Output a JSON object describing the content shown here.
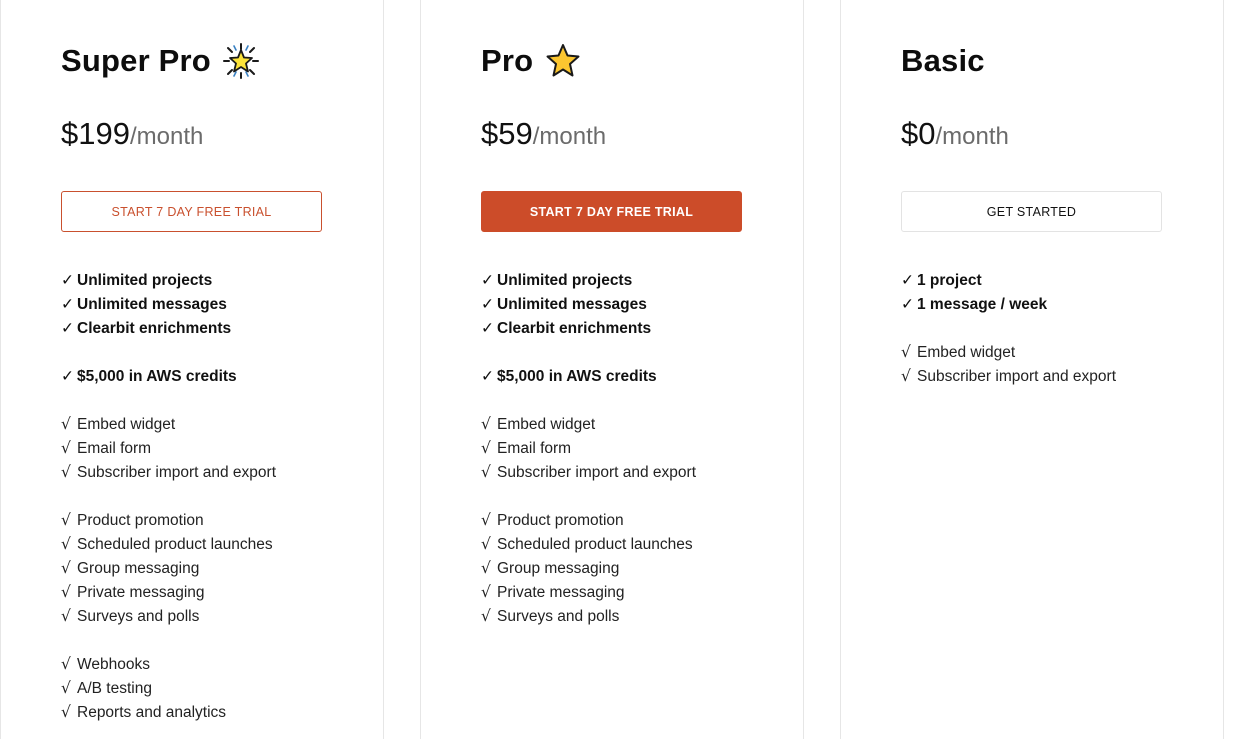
{
  "plans": [
    {
      "name": "Super Pro",
      "icon": "sparkle-star-icon",
      "price": "$199",
      "period": "/month",
      "cta": "START 7 DAY FREE TRIAL",
      "cta_style": "outline-accent",
      "groups": [
        {
          "bold": true,
          "items": [
            "Unlimited projects",
            "Unlimited messages",
            "Clearbit enrichments"
          ]
        },
        {
          "bold": true,
          "items": [
            "$5,000 in AWS credits"
          ]
        },
        {
          "bold": false,
          "items": [
            "Embed widget",
            "Email form",
            "Subscriber import and export"
          ]
        },
        {
          "bold": false,
          "items": [
            "Product promotion",
            "Scheduled product launches",
            "Group messaging",
            "Private messaging",
            "Surveys and polls"
          ]
        },
        {
          "bold": false,
          "items": [
            "Webhooks",
            "A/B testing",
            "Reports and analytics"
          ]
        }
      ]
    },
    {
      "name": "Pro",
      "icon": "star-icon",
      "price": "$59",
      "period": "/month",
      "cta": "START 7 DAY FREE TRIAL",
      "cta_style": "filled",
      "groups": [
        {
          "bold": true,
          "items": [
            "Unlimited projects",
            "Unlimited messages",
            "Clearbit enrichments"
          ]
        },
        {
          "bold": true,
          "items": [
            "$5,000 in AWS credits"
          ]
        },
        {
          "bold": false,
          "items": [
            "Embed widget",
            "Email form",
            "Subscriber import and export"
          ]
        },
        {
          "bold": false,
          "items": [
            "Product promotion",
            "Scheduled product launches",
            "Group messaging",
            "Private messaging",
            "Surveys and polls"
          ]
        }
      ]
    },
    {
      "name": "Basic",
      "icon": "",
      "price": "$0",
      "period": "/month",
      "cta": "GET STARTED",
      "cta_style": "plain",
      "groups": [
        {
          "bold": true,
          "items": [
            "1 project",
            "1 message / week"
          ]
        },
        {
          "bold": false,
          "items": [
            "Embed widget",
            "Subscriber import and export"
          ]
        }
      ]
    }
  ],
  "check_glyph_bold": "✓",
  "check_glyph_light": "√",
  "colors": {
    "accent": "#cc4c29",
    "star_yellow": "#fcc630",
    "card_border": "#e6e6e6"
  }
}
